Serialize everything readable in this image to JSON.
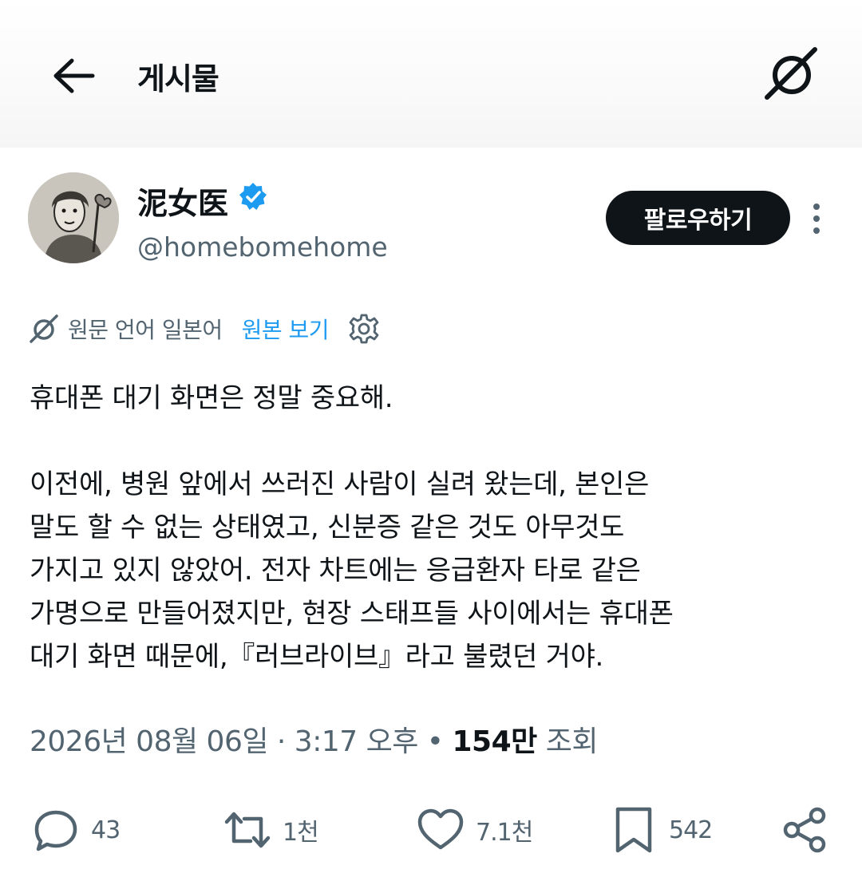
{
  "header": {
    "title": "게시물",
    "back_icon": "arrow-left-icon",
    "grok_icon": "grok-icon"
  },
  "author": {
    "name": "泥女医",
    "handle": "@homebomehome",
    "verified": true,
    "follow_label": "팔로우하기"
  },
  "translation": {
    "label": "원문 언어 일본어",
    "link": "원본 보기"
  },
  "post": {
    "text": "휴대폰 대기 화면은 정말 중요해.\n\n이전에, 병원 앞에서 쓰러진 사람이 실려 왔는데, 본인은\n말도 할 수 없는 상태였고, 신분증 같은 것도 아무것도\n가지고 있지 않았어. 전자 차트에는 응급환자 타로 같은\n가명으로 만들어졌지만, 현장 스태프들 사이에서는 휴대폰\n대기 화면 때문에,『러브라이브』라고 불렸던 거야."
  },
  "meta": {
    "datetime": "2026년 08월 06일 · 3:17 오후",
    "separator": "•",
    "views_count": "154만",
    "views_label": "조회"
  },
  "actions": {
    "replies": "43",
    "reposts": "1천",
    "likes": "7.1천",
    "bookmarks": "542"
  },
  "colors": {
    "accent": "#1d9bf0",
    "text": "#0f1419",
    "secondary": "#536471"
  }
}
